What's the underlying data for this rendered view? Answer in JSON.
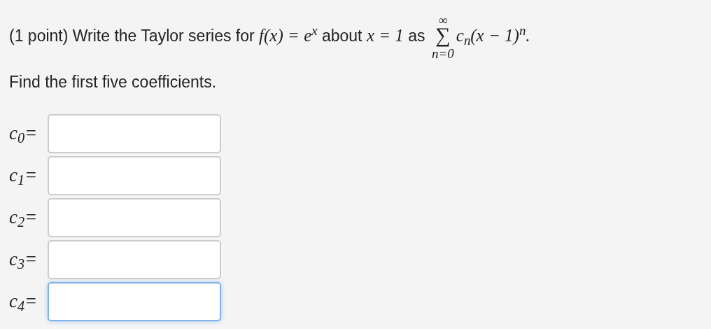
{
  "question": {
    "parts": [
      {
        "kind": "text",
        "text": "(1 point) Write the Taylor series for "
      },
      {
        "kind": "math",
        "text": "f(x) = e$^{x}$"
      },
      {
        "kind": "text",
        "text": " about "
      },
      {
        "kind": "math",
        "text": "x = 1"
      },
      {
        "kind": "text",
        "text": " as "
      },
      {
        "kind": "sum",
        "upper": "∞",
        "symbol": "∑",
        "lower": "n=0"
      },
      {
        "kind": "math",
        "text": "c$_{n}$(x − 1)$^{n}$."
      }
    ]
  },
  "instruction": "Find the first five coefficients.",
  "answers": [
    {
      "label": "c$_{0}$=",
      "focused": false
    },
    {
      "label": "c$_{1}$=",
      "focused": false
    },
    {
      "label": "c$_{2}$=",
      "focused": false
    },
    {
      "label": "c$_{3}$=",
      "focused": false
    },
    {
      "label": "c$_{4}$=",
      "focused": true
    }
  ]
}
